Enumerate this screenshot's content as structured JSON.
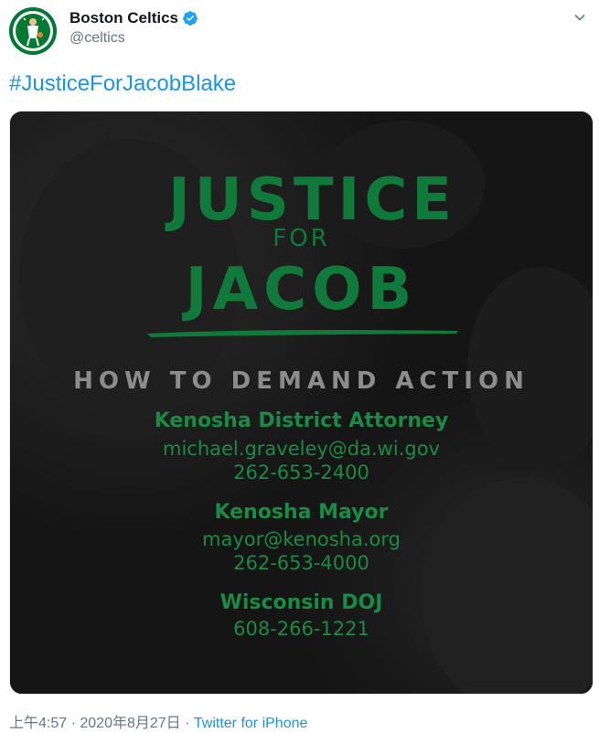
{
  "tweet": {
    "display_name": "Boston Celtics",
    "handle": "@celtics",
    "hashtag": "#JusticeForJacobBlake",
    "avatar_icon": "celtics-logo",
    "verified_icon": "verified-badge-icon",
    "caret_icon": "chevron-down-icon"
  },
  "poster": {
    "title_line1": "JUSTICE",
    "title_line2": "FOR",
    "title_line3": "JACOB",
    "subtitle": "HOW TO DEMAND ACTION",
    "contacts": [
      {
        "title": "Kenosha District Attorney",
        "email": "michael.graveley@da.wi.gov",
        "phone": "262-653-2400"
      },
      {
        "title": "Kenosha Mayor",
        "email": "mayor@kenosha.org",
        "phone": "262-653-4000"
      },
      {
        "title": "Wisconsin DOJ",
        "phone": "608-266-1221"
      }
    ]
  },
  "meta": {
    "time": "上午4:57",
    "separator": " · ",
    "date": "2020年8月27日",
    "source": "Twitter for iPhone"
  },
  "colors": {
    "link": "#1b95e0",
    "secondary_text": "#657786",
    "celtics_green": "#007a33",
    "poster_green": "#1a8a44"
  }
}
